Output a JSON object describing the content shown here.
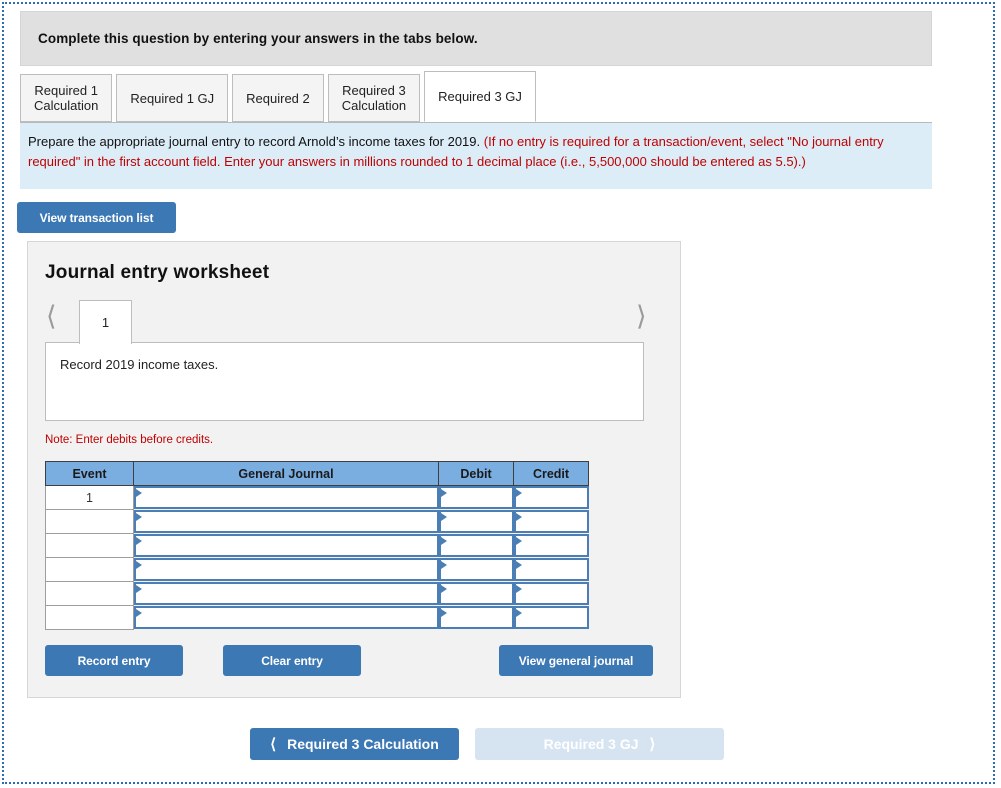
{
  "prompt": {
    "text": "Complete this question by entering your answers in the tabs below."
  },
  "tabs": [
    {
      "name": "tab-required-1-calculation",
      "line1": "Required 1",
      "line2": "Calculation",
      "active": false
    },
    {
      "name": "tab-required-1-gj",
      "line1": "Required 1 GJ",
      "line2": "",
      "active": false
    },
    {
      "name": "tab-required-2",
      "line1": "Required 2",
      "line2": "",
      "active": false
    },
    {
      "name": "tab-required-3-calculation",
      "line1": "Required 3",
      "line2": "Calculation",
      "active": false
    },
    {
      "name": "tab-required-3-gj",
      "line1": "Required 3 GJ",
      "line2": "",
      "active": true
    }
  ],
  "instructions": {
    "black": "Prepare the appropriate journal entry to record Arnold’s income taxes for 2019.",
    "red": "(If no entry is required for a transaction/event, select \"No journal entry required\" in the first account field. Enter your answers in millions rounded to 1 decimal place (i.e., 5,500,000 should be entered as 5.5).)"
  },
  "toolbar": {
    "view_transaction_list_label": "View transaction list"
  },
  "worksheet": {
    "title": "Journal entry worksheet",
    "pager": {
      "prev_icon": "chevron-left-icon",
      "next_icon": "chevron-right-icon",
      "pages": [
        "1"
      ],
      "active_page": "1"
    },
    "description": "Record 2019 income taxes.",
    "note": "Note: Enter debits before credits.",
    "table": {
      "headers": [
        "Event",
        "General Journal",
        "Debit",
        "Credit"
      ],
      "rows": [
        {
          "event": "1",
          "general_journal": "",
          "debit": "",
          "credit": ""
        },
        {
          "event": "",
          "general_journal": "",
          "debit": "",
          "credit": ""
        },
        {
          "event": "",
          "general_journal": "",
          "debit": "",
          "credit": ""
        },
        {
          "event": "",
          "general_journal": "",
          "debit": "",
          "credit": ""
        },
        {
          "event": "",
          "general_journal": "",
          "debit": "",
          "credit": ""
        },
        {
          "event": "",
          "general_journal": "",
          "debit": "",
          "credit": ""
        }
      ]
    },
    "buttons": {
      "record_entry": "Record entry",
      "clear_entry": "Clear entry",
      "view_general_journal": "View general journal"
    }
  },
  "bottom_nav": {
    "prev_label": "Required 3 Calculation",
    "prev_icon": "chevron-left-icon",
    "next_label": "Required 3 GJ",
    "next_icon": "chevron-right-icon",
    "next_disabled": true
  },
  "colors": {
    "accent_blue": "#3C78B4",
    "header_blue": "#7BAEE0",
    "panel_blue": "#DCEDF8",
    "note_red": "#C00000",
    "disabled_blue": "#D6E4F2",
    "frame_dotted": "#2F6BAE"
  }
}
